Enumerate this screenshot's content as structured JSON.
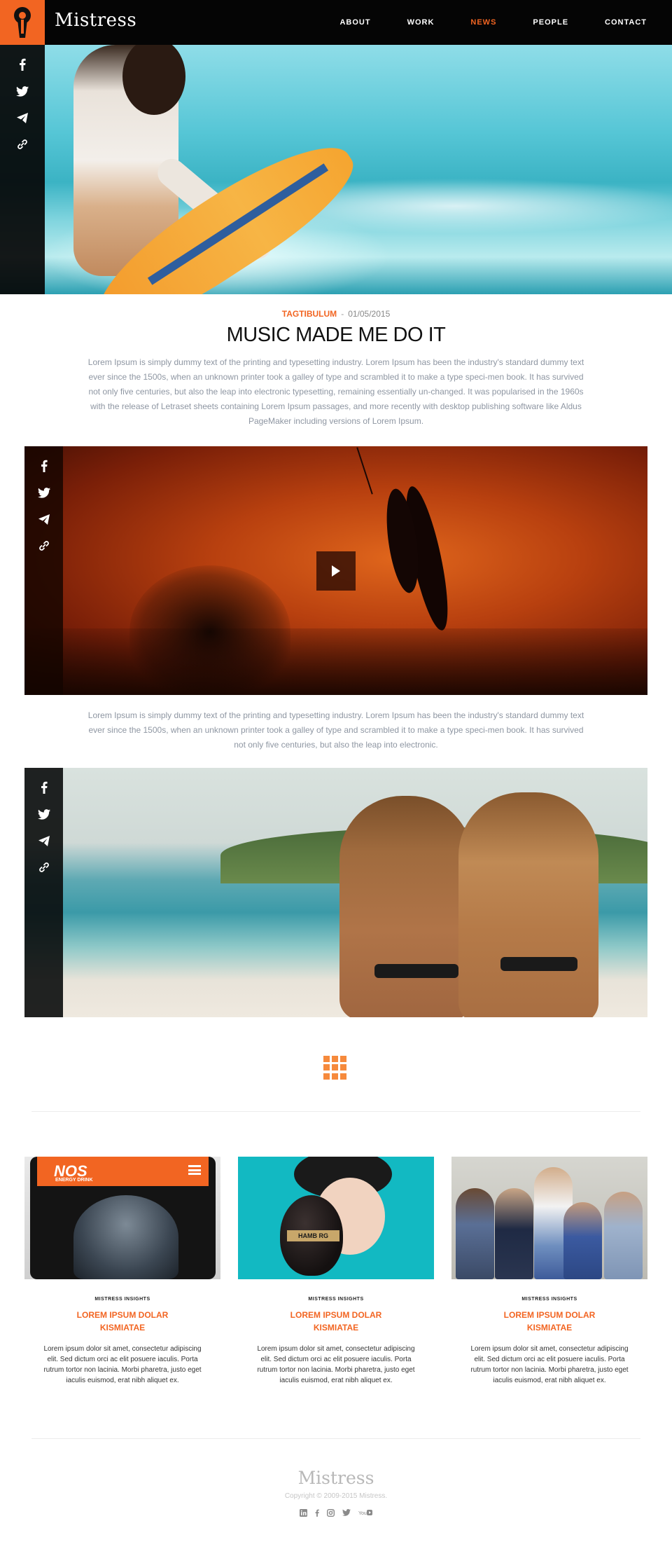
{
  "brand": {
    "name": "Mistress"
  },
  "nav": {
    "items": [
      "ABOUT",
      "WORK",
      "NEWS",
      "PEOPLE",
      "CONTACT"
    ],
    "active": "NEWS"
  },
  "colors": {
    "accent": "#f26522",
    "header_bg": "#050505",
    "body_text": "#8e96a2"
  },
  "share_icons": [
    "facebook-icon",
    "twitter-icon",
    "paper-plane-icon",
    "link-icon"
  ],
  "article": {
    "tag": "TAGTIBULUM",
    "separator": "-",
    "date": "01/05/2015",
    "title": "MUSIC MADE ME DO IT",
    "paragraph_1": "Lorem Ipsum is simply dummy text of the printing and typesetting industry. Lorem Ipsum has been the industry's standard dummy text ever since the 1500s, when an unknown printer took a galley of type and scrambled it to make a type speci-men book. It has survived not only five centuries, but also the leap into electronic typesetting, remaining essentially un-changed. It was popularised in the 1960s with the release of Letraset sheets containing Lorem Ipsum passages, and more recently with desktop publishing software like Aldus PageMaker including versions of Lorem Ipsum.",
    "paragraph_2": "Lorem Ipsum is simply dummy text of the printing and typesetting industry. Lorem Ipsum has been the industry's standard dummy text ever since the 1500s, when an unknown printer took a galley of type and scrambled it to make a type speci-men book. It has survived not only five centuries, but also the leap into electronic."
  },
  "cards": [
    {
      "kicker": "MISTRESS INSIGHTS",
      "title": "LOREM IPSUM DOLAR KISMIATAE",
      "body": "Lorem ipsum dolor sit amet, consectetur adipiscing elit. Sed dictum orci ac elit posuere iaculis. Porta rutrum tortor non lacinia. Morbi pharetra, justo eget iaculis euismod, erat nibh aliquet ex.",
      "image_text": "NOS",
      "image_subtext": "ENERGY DRINK"
    },
    {
      "kicker": "MISTRESS INSIGHTS",
      "title": "LOREM IPSUM DOLAR KISMIATAE",
      "body": "Lorem ipsum dolor sit amet, consectetur adipiscing elit. Sed dictum orci ac elit posuere iaculis. Porta rutrum tortor non lacinia. Morbi pharetra, justo eget iaculis euismod, erat nibh aliquet ex.",
      "image_text": "HAMB RG"
    },
    {
      "kicker": "MISTRESS INSIGHTS",
      "title": "LOREM IPSUM DOLAR KISMIATAE",
      "body": "Lorem ipsum dolor sit amet, consectetur adipiscing elit. Sed dictum orci ac elit posuere iaculis. Porta rutrum tortor non lacinia. Morbi pharetra, justo eget iaculis euismod, erat nibh aliquet ex."
    }
  ],
  "footer": {
    "brand": "Mistress",
    "copyright": "Copyright © 2009-2015 Mistress.",
    "social": [
      "linkedin-icon",
      "facebook-icon",
      "instagram-icon",
      "twitter-icon",
      "youtube-icon"
    ]
  }
}
